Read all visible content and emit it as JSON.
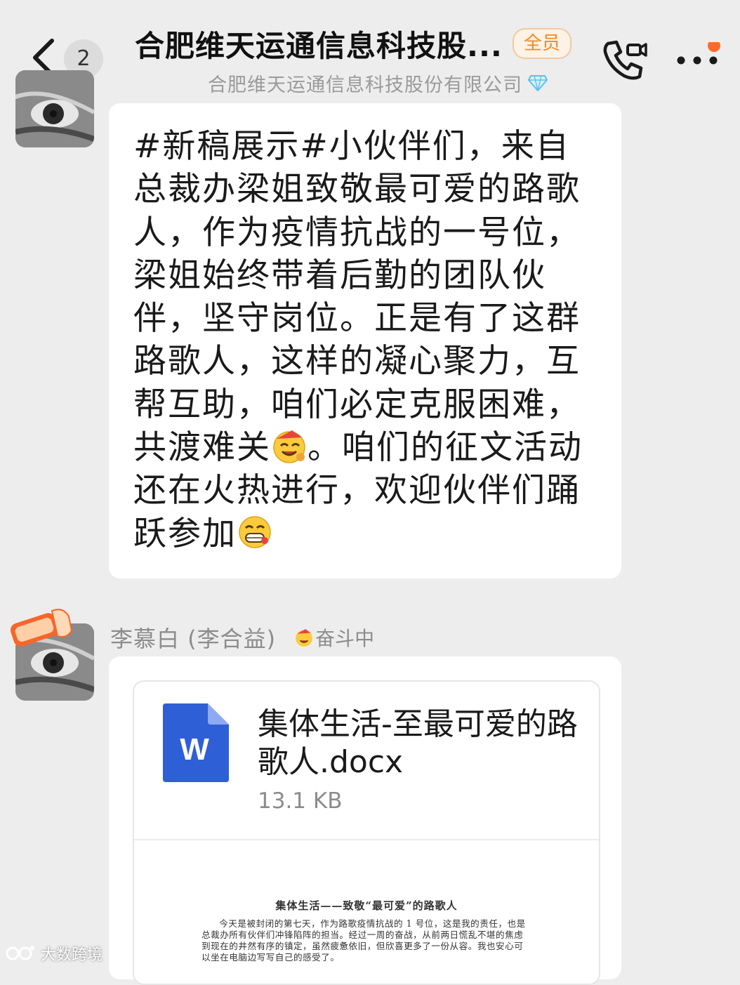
{
  "header": {
    "unread_count": "2",
    "title": "合肥维天运通信息科技股...",
    "member_tag": "全员",
    "subtitle": "合肥维天运通信息科技股份有限公司",
    "icons": {
      "back": "back-arrow-icon",
      "verified": "diamond-icon",
      "call": "video-call-icon",
      "more": "more-icon"
    },
    "colors": {
      "accent": "#f08a24",
      "notification_dot": "#ff6a2b",
      "diamond": "#5bc0f0"
    }
  },
  "messages": [
    {
      "text_parts": [
        "#新稿展示#小伙伴们，来自总裁办梁姐致敬最可爱的路歌人，作为疫情抗战的一号位，梁姐始终带着后勤的团队伙伴，坚守岗位。正是有了这群路歌人，这样的凝心聚力，互帮互助，咱们必定克服困难，共渡难关",
        "。咱们的征文活动还在火热进行，欢迎伙伴们踊跃参加"
      ],
      "emojis": [
        "party-face-emoji",
        "grinning-face-emoji"
      ]
    },
    {
      "sender_name": "李慕白 (李合益)",
      "sender_status": "奋斗中",
      "sticker": "bonus-sticker",
      "file": {
        "name": "集体生活-至最可爱的路歌人.docx",
        "size": "13.1 KB",
        "icon_letter": "W",
        "icon_color": "#2f5fd6",
        "preview_title": "集体生活——致敬“最可爱”的路歌人",
        "preview_body": "今天是被封闭的第七天，作为路歌疫情抗战的 1 号位，这是我的责任，也是总裁办所有伙伴们冲锋陷阵的担当。经过一周的奋战，从前两日慌乱不堪的焦虑到现在的井然有序的镇定，虽然疲惫依旧，但欣喜更多了一份从容。我也安心可以坐在电脑边写写自己的感受了。"
      }
    }
  ],
  "watermark": {
    "text": "大数跨境"
  }
}
